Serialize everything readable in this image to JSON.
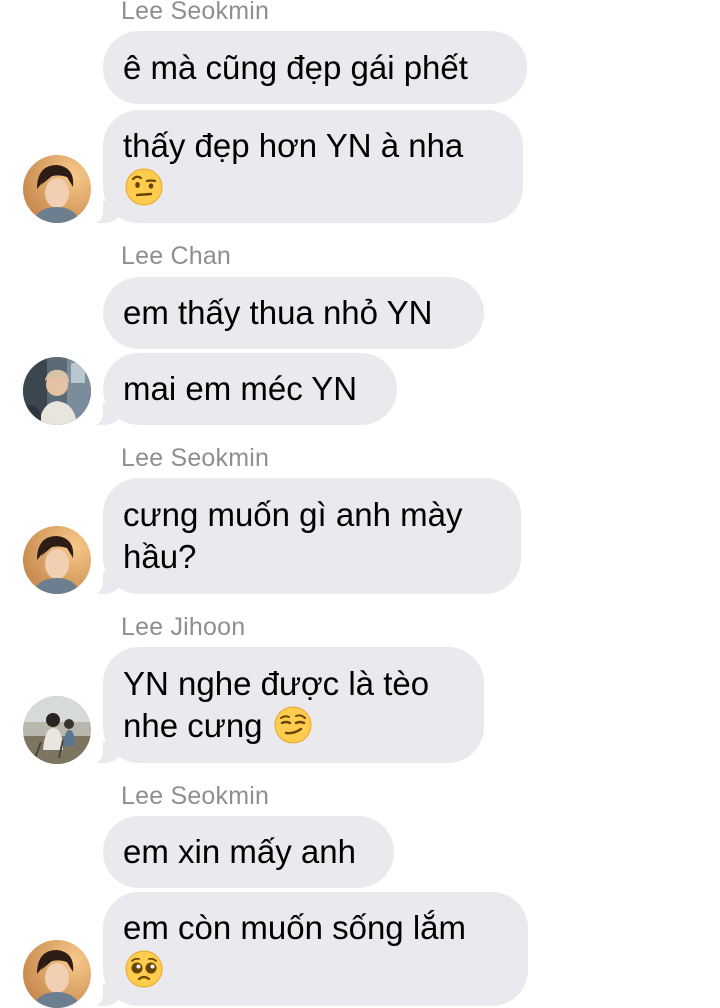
{
  "chat": {
    "messages": [
      {
        "sender": "Lee Seokmin"
      },
      {
        "text": "ê mà cũng đẹp gái phết"
      },
      {
        "line1": "thấy đẹp hơn YN à nha",
        "emoji": "raised-eyebrow-emoji"
      },
      {
        "sender": "Lee Chan"
      },
      {
        "text": "em thấy thua nhỏ YN"
      },
      {
        "text": "mai em méc YN"
      },
      {
        "sender": "Lee Seokmin"
      },
      {
        "line1": "cưng muốn gì anh mày",
        "line2": "hầu?"
      },
      {
        "sender": "Lee Jihoon"
      },
      {
        "line1": "YN nghe được là tèo",
        "line2": "nhe cưng",
        "emoji": "smirking-face-emoji"
      },
      {
        "sender": "Lee Seokmin"
      },
      {
        "text": "em xin mấy anh"
      },
      {
        "line1": "em còn muốn sống lắm",
        "emoji": "pleading-face-emoji"
      }
    ]
  },
  "colors": {
    "bubble": "#e9e9ee",
    "sender_name": "#8e8e93",
    "text": "#000000",
    "background": "#ffffff"
  }
}
